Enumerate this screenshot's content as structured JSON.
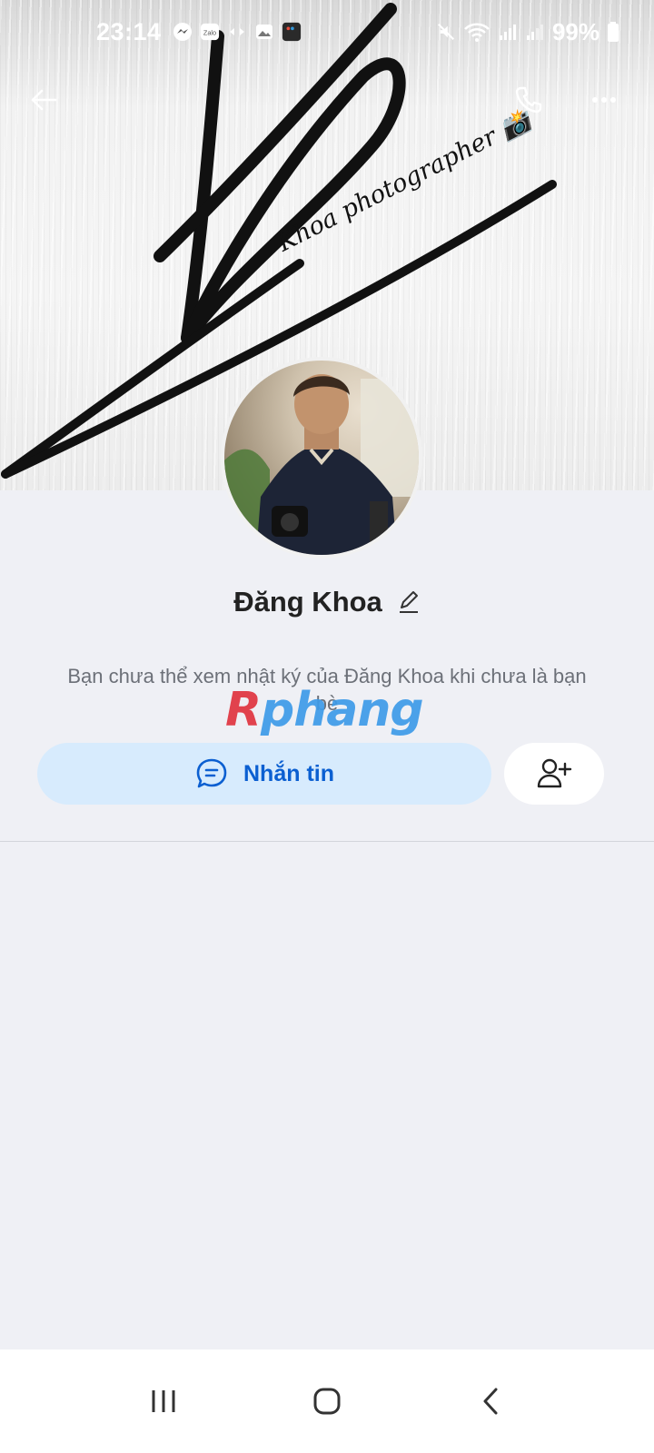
{
  "status_bar": {
    "time": "23:14",
    "battery": "99%",
    "icons_left": [
      "messenger-icon",
      "zalo-icon",
      "data-transfer-icon",
      "gallery-icon",
      "video-app-icon"
    ],
    "zalo_label": "Zalo",
    "icons_right": [
      "mute-icon",
      "wifi-icon",
      "signal-icon",
      "signal-icon-2",
      "battery-icon"
    ]
  },
  "cover": {
    "caption": "Khoa photographer 📸"
  },
  "profile": {
    "name": "Đăng Khoa",
    "info_text": "Bạn chưa thể xem nhật ký của Đăng Khoa khi chưa là bạn bè"
  },
  "watermark": {
    "part_a": "R",
    "part_b": "phang"
  },
  "actions": {
    "message_label": "Nhắn tin"
  },
  "colors": {
    "accent": "#0b5fd1",
    "message_button_bg": "#d7ebfd",
    "page_bg": "#eff0f5"
  }
}
